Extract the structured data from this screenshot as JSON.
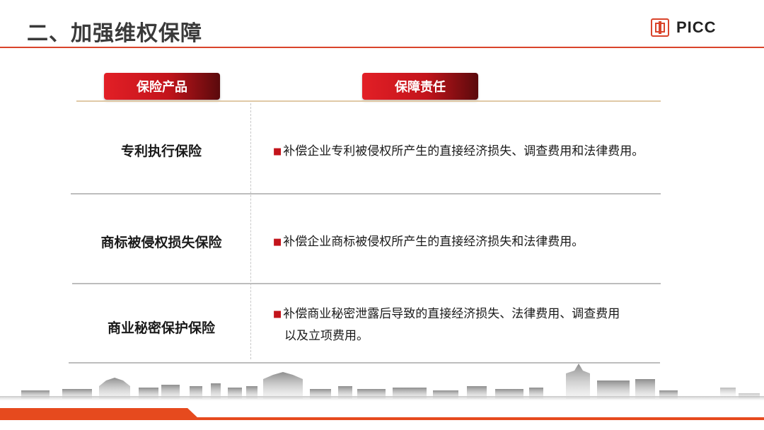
{
  "header": {
    "title": "二、加强维权保障",
    "logo_text": "PICC"
  },
  "table": {
    "columns": [
      "保险产品",
      "保障责任"
    ],
    "rows": [
      {
        "product": "专利执行保险",
        "duty_lines": [
          "补偿企业专利被侵权所产生的直接经济损失、调查费用和法律费用。"
        ]
      },
      {
        "product": "商标被侵权损失保险",
        "duty_lines": [
          "补偿企业商标被侵权所产生的直接经济损失和法律费用。"
        ]
      },
      {
        "product": "商业秘密保护保险",
        "duty_lines": [
          "补偿商业秘密泄露后导致的直接经济损失、法律费用、调查费用",
          "以及立项费用。"
        ]
      }
    ]
  },
  "bullet_glyph": "■",
  "colors": {
    "accent_red": "#d9442b",
    "pill_red": "#c3141b",
    "band_orange": "#e64a1e"
  }
}
